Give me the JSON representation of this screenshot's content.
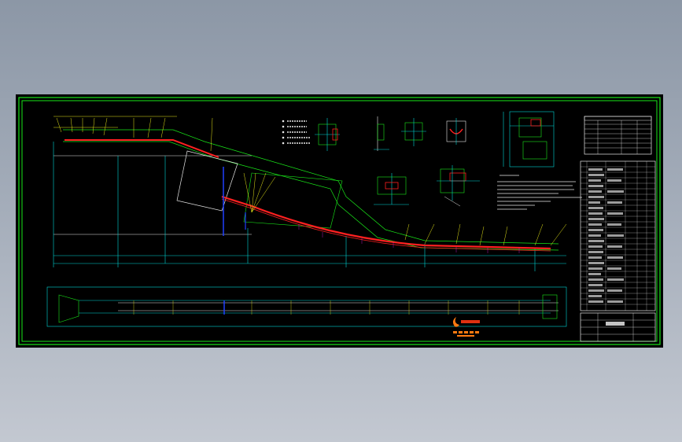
{
  "app": {
    "window_title": ""
  },
  "drawing": {
    "title_block_name": "",
    "notes_heading": "",
    "logo_caption": ""
  },
  "colors": {
    "background_top": "#8c97a6",
    "background_bottom": "#c3c8d1",
    "sheet": "#000000",
    "frame": "#19e619",
    "dimension": "#00d6d6",
    "conveyor": "#ff2020",
    "annotation": "#e6e619"
  },
  "icons": {
    "logo": "company-logo-icon"
  }
}
